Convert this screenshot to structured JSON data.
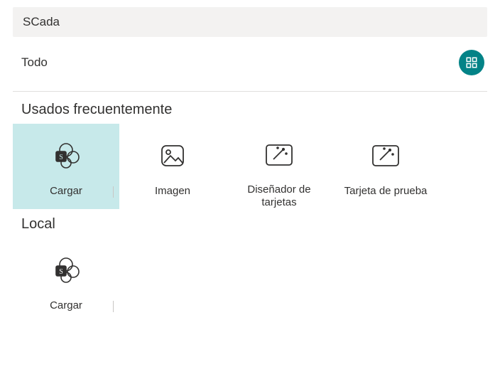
{
  "search": {
    "value": "SCada"
  },
  "filter": {
    "label": "Todo",
    "grid_icon": "grid-icon"
  },
  "sections": {
    "frequent": {
      "title": "Usados frecuentemente",
      "items": [
        {
          "label": "Cargar",
          "icon": "sharepoint-icon",
          "selected": true
        },
        {
          "label": "Imagen",
          "icon": "picture-icon"
        },
        {
          "label": "Diseñador de tarjetas",
          "icon": "wand-icon"
        },
        {
          "label": "Tarjeta de prueba",
          "icon": "wand-icon"
        }
      ]
    },
    "local": {
      "title": "Local",
      "items": [
        {
          "label": "Cargar",
          "icon": "sharepoint-icon"
        }
      ]
    }
  }
}
